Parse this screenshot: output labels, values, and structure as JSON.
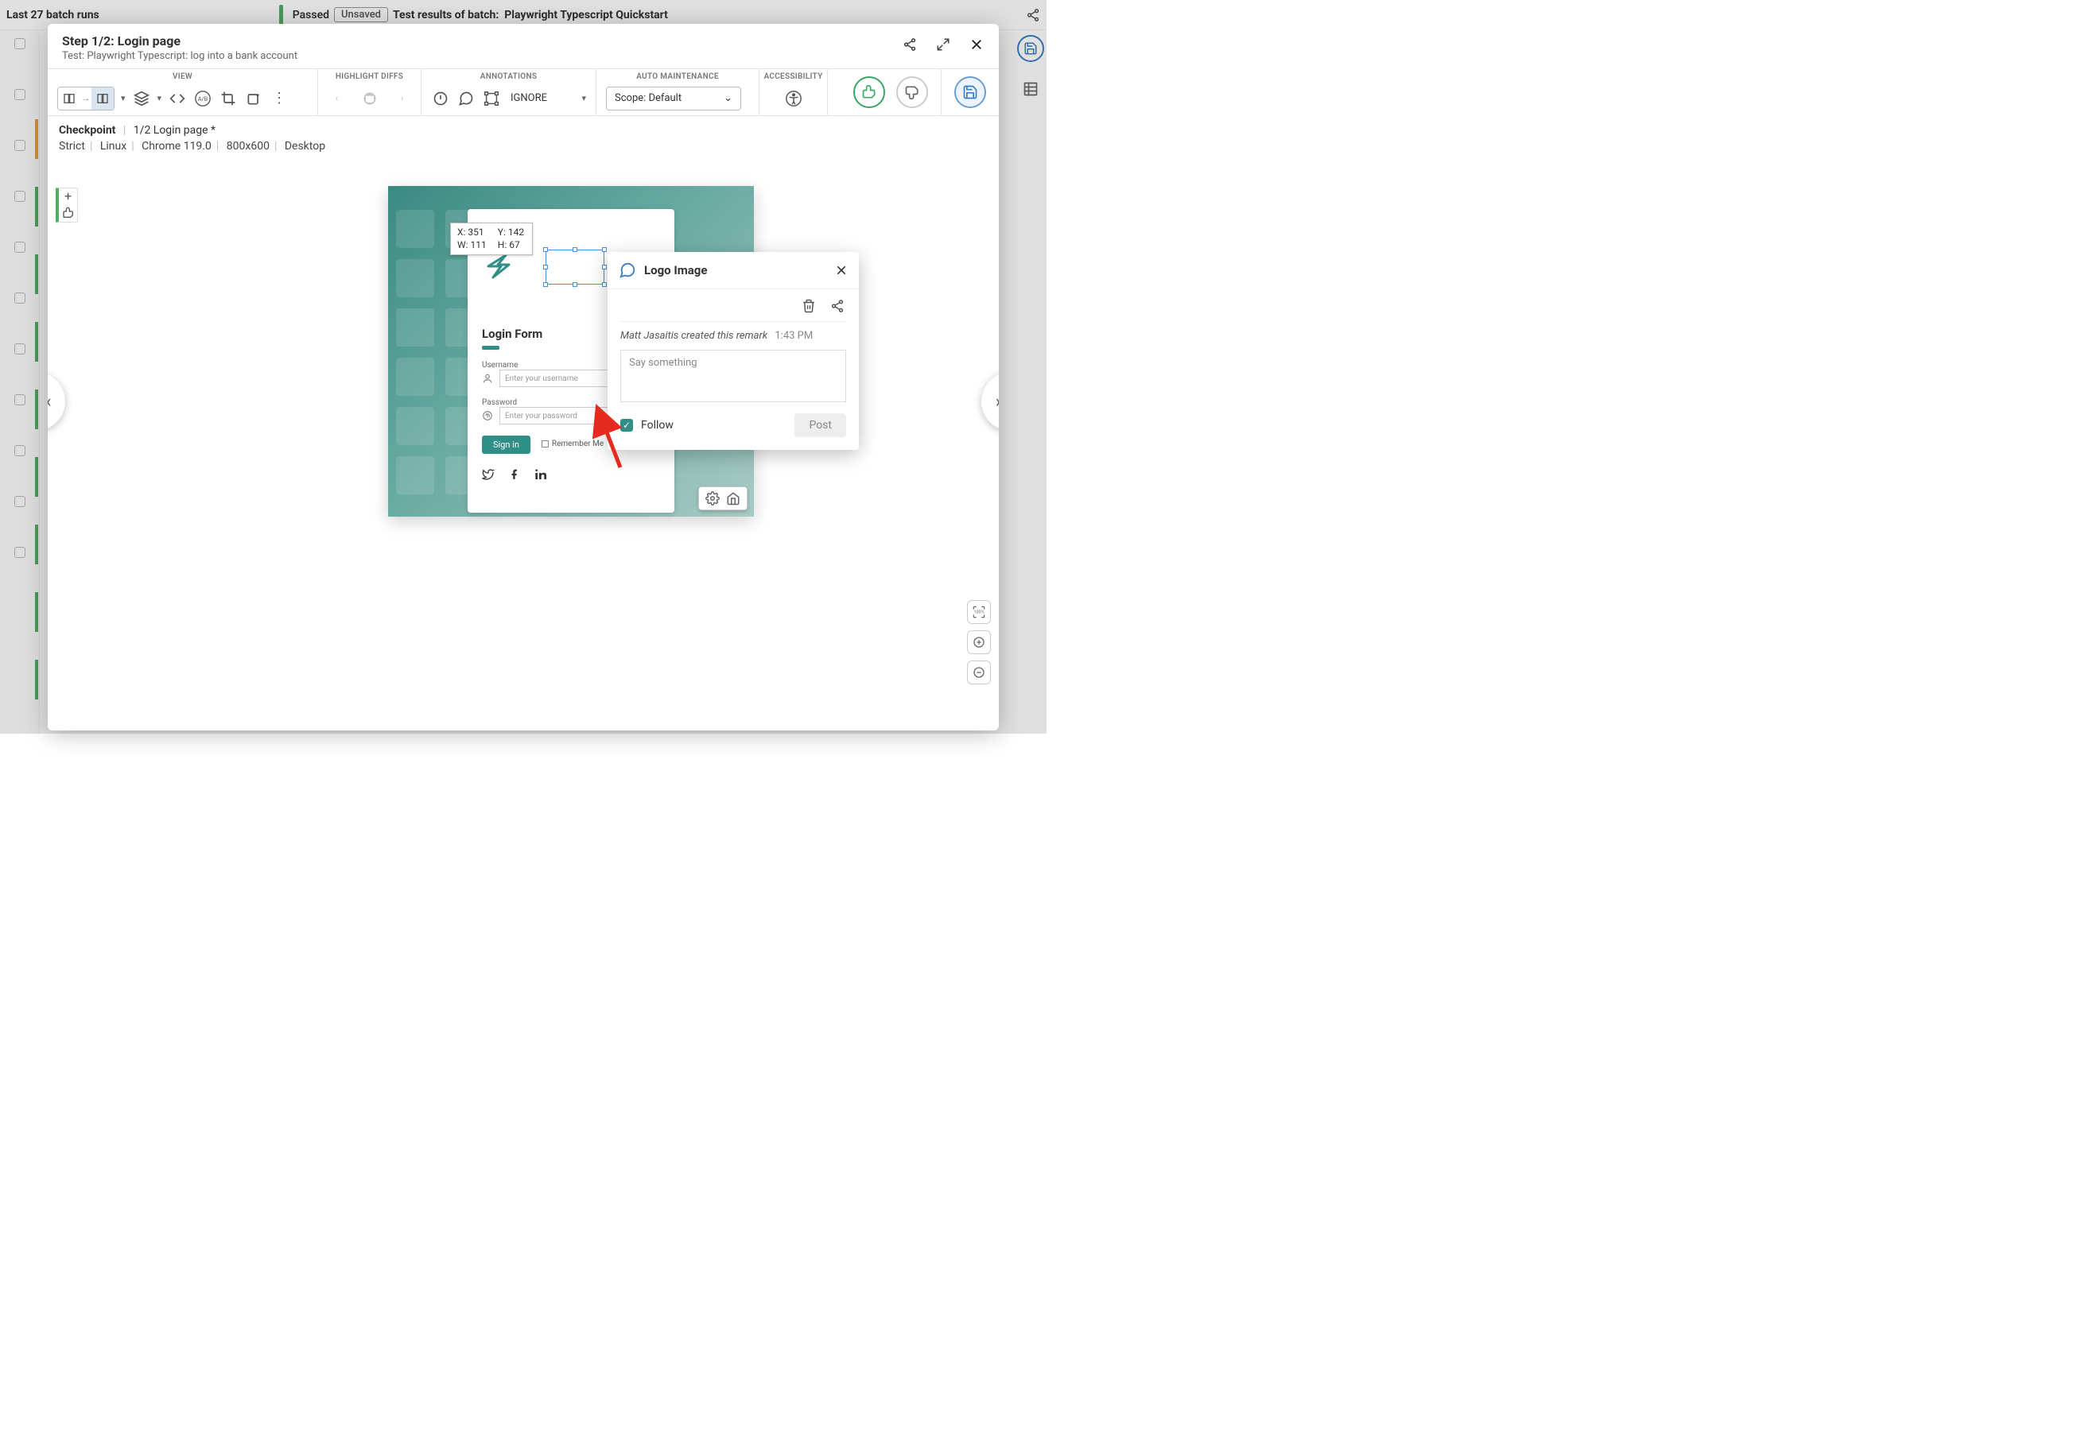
{
  "bg": {
    "last_runs": "Last 27 batch runs",
    "passed": "Passed",
    "unsaved": "Unsaved",
    "results_prefix": "Test results of batch:",
    "results_name": "Playwright Typescript Quickstart"
  },
  "modal": {
    "title": "Step 1/2:  Login page",
    "subtitle": "Test: Playwright Typescript: log into a bank account"
  },
  "toolbar": {
    "view": "VIEW",
    "highlight": "HIGHLIGHT DIFFS",
    "annotations": "ANNOTATIONS",
    "auto_maint": "AUTO MAINTENANCE",
    "accessibility": "ACCESSIBILITY",
    "ignore": "IGNORE",
    "scope": "Scope: Default"
  },
  "breadcrumb": {
    "checkpoint": "Checkpoint",
    "step": "1/2 Login page *",
    "strict": "Strict",
    "os": "Linux",
    "browser": "Chrome 119.0",
    "viewport": "800x600",
    "device": "Desktop"
  },
  "selection": {
    "x_label": "X: 351",
    "y_label": "Y: 142",
    "w_label": "W: 111",
    "h_label": "H: 67"
  },
  "form": {
    "title": "Login Form",
    "username_label": "Username",
    "username_ph": "Enter your username",
    "password_label": "Password",
    "password_ph": "Enter your password",
    "signin": "Sign in",
    "remember": "Remember Me"
  },
  "popover": {
    "title": "Logo Image",
    "author": "Matt Jasaitis created this remark",
    "time": "1:43 PM",
    "placeholder": "Say something",
    "follow": "Follow",
    "post": "Post"
  },
  "zoom": {
    "fit": "100%"
  }
}
